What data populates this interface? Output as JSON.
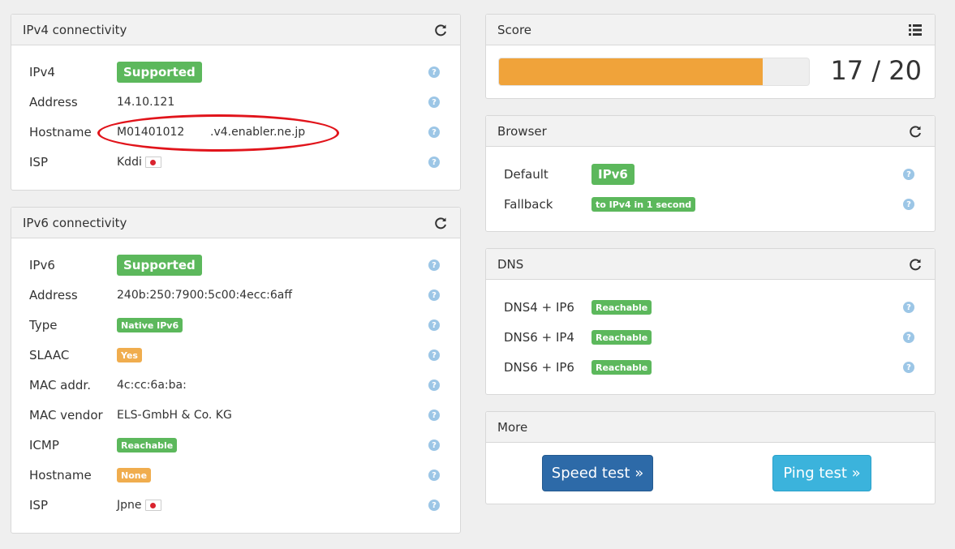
{
  "ipv4": {
    "title": "IPv4 connectivity",
    "refresh_icon": "refresh-icon",
    "rows": [
      {
        "label": "IPv4",
        "value": "Supported"
      },
      {
        "label": "Address",
        "value": "14.10.121"
      },
      {
        "label": "Hostname",
        "value_a": "M01401012",
        "value_b": ".v4.enabler.ne.jp"
      },
      {
        "label": "ISP",
        "value": "Kddi"
      }
    ]
  },
  "ipv6": {
    "title": "IPv6 connectivity",
    "refresh_icon": "refresh-icon",
    "rows": [
      {
        "label": "IPv6",
        "value": "Supported"
      },
      {
        "label": "Address",
        "value": "240b:250:7900:5c00:4ecc:6aff"
      },
      {
        "label": "Type",
        "value": "Native IPv6"
      },
      {
        "label": "SLAAC",
        "value": "Yes"
      },
      {
        "label": "MAC addr.",
        "value": "4c:cc:6a:ba:"
      },
      {
        "label": "MAC vendor",
        "value": "ELS-GmbH & Co. KG"
      },
      {
        "label": "ICMP",
        "value": "Reachable"
      },
      {
        "label": "Hostname",
        "value": "None"
      },
      {
        "label": "ISP",
        "value": "Jpne"
      }
    ]
  },
  "score": {
    "title": "Score",
    "list_icon": "list-icon",
    "value_text": "17 / 20",
    "fraction": 0.85
  },
  "browser": {
    "title": "Browser",
    "rows": [
      {
        "label": "Default",
        "value": "IPv6"
      },
      {
        "label": "Fallback",
        "value": "to IPv4 in 1 second"
      }
    ]
  },
  "dns": {
    "title": "DNS",
    "rows": [
      {
        "label": "DNS4 + IP6",
        "value": "Reachable"
      },
      {
        "label": "DNS6 + IP4",
        "value": "Reachable"
      },
      {
        "label": "DNS6 + IP6",
        "value": "Reachable"
      }
    ]
  },
  "more": {
    "title": "More",
    "speed_test": "Speed test »",
    "ping_test": "Ping test »"
  },
  "help_glyph": "?",
  "colors": {
    "green": "#5cb85c",
    "orange": "#f0ad4e",
    "progress": "#f0a33a",
    "link": "#3a7bbf",
    "annotation": "#e1141b"
  }
}
